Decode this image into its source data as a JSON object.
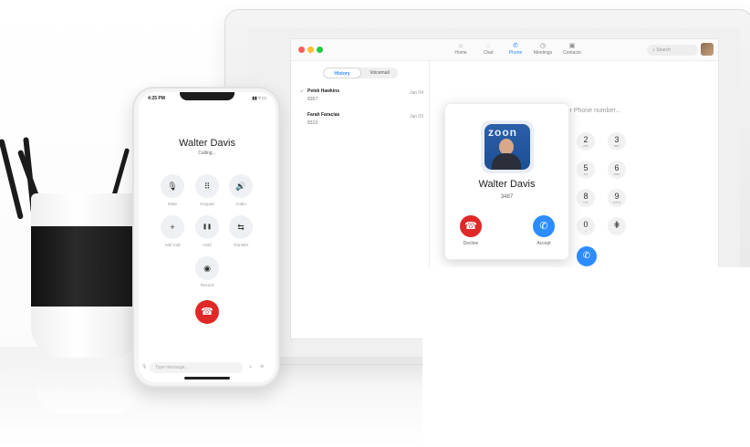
{
  "desktop": {
    "nav": [
      {
        "icon": "home-icon",
        "glyph": "⌂",
        "label": "Home"
      },
      {
        "icon": "chat-icon",
        "glyph": "◌",
        "label": "Chat"
      },
      {
        "icon": "phone-icon",
        "glyph": "✆",
        "label": "Phone"
      },
      {
        "icon": "meetings-icon",
        "glyph": "◷",
        "label": "Meetings"
      },
      {
        "icon": "contacts-icon",
        "glyph": "▣",
        "label": "Contacts"
      }
    ],
    "search_label": "Search",
    "tabs": {
      "history": "History",
      "voicemail": "Voicemail"
    },
    "history": [
      {
        "name": "Petek Hawkins",
        "number": "8357",
        "date": "Jan 04"
      },
      {
        "name": "Farah Faracias",
        "number": "8315",
        "date": "Jan 03"
      }
    ],
    "dial_hint": "me or Phone number...",
    "keys": [
      {
        "digit": "2",
        "letters": "ABC"
      },
      {
        "digit": "3",
        "letters": "DEF"
      },
      {
        "digit": "5",
        "letters": "JKL"
      },
      {
        "digit": "6",
        "letters": "MNO"
      },
      {
        "digit": "8",
        "letters": "TUV"
      },
      {
        "digit": "9",
        "letters": "WXYZ"
      },
      {
        "digit": "0",
        "letters": "+"
      },
      {
        "digit": "⋕",
        "letters": ""
      }
    ],
    "incoming": {
      "logo_text": "zoon",
      "caller": "Walter Davis",
      "number": "3487",
      "decline": "Decline",
      "accept": "Accept"
    }
  },
  "phone": {
    "time": "4:25 PM",
    "status": "▮▮ ≈ ▭",
    "caller": "Walter Davis",
    "state": "Calling...",
    "controls": [
      {
        "icon": "mute-icon",
        "glyph": "🎙",
        "label": "Mute"
      },
      {
        "icon": "keypad-icon",
        "glyph": "⠿",
        "label": "Keypad"
      },
      {
        "icon": "audio-icon",
        "glyph": "🔊",
        "label": "Audio"
      },
      {
        "icon": "add-call-icon",
        "glyph": "+",
        "label": "Add Call"
      },
      {
        "icon": "hold-icon",
        "glyph": "❚❚",
        "label": "Hold"
      },
      {
        "icon": "transfer-icon",
        "glyph": "⇆",
        "label": "Transfer"
      },
      {
        "icon": "record-icon",
        "glyph": "◉",
        "label": "Record"
      }
    ],
    "message_placeholder": "Type message..."
  },
  "colors": {
    "accent": "#2d8cff",
    "decline": "#e02828"
  }
}
